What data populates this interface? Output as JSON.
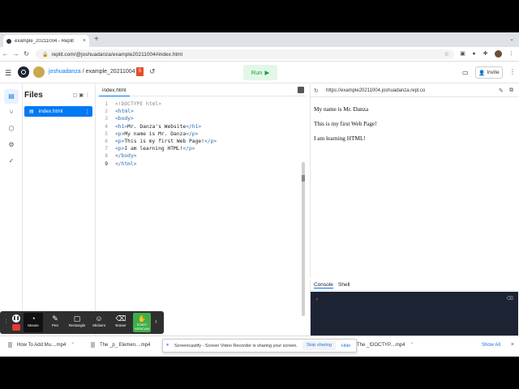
{
  "browser": {
    "tab_title": "example_20211004 - Replit",
    "tab_close": "×",
    "new_tab": "+",
    "url": "replit.com/@joshuadanza/example20211004#index.html"
  },
  "header": {
    "username": "joshuadanza",
    "separator": "/",
    "repl_name": "example_20211004",
    "html_badge": "5",
    "run_label": "Run",
    "invite_label": "Invite"
  },
  "files_panel": {
    "title": "Files",
    "items": [
      {
        "name": "index.html"
      }
    ]
  },
  "editor": {
    "tab_label": "index.html",
    "active_line": 9,
    "lines": [
      {
        "num": "1",
        "parts": [
          {
            "cls": "doctype",
            "text": "<!DOCTYPE html>"
          }
        ]
      },
      {
        "num": "2",
        "parts": [
          {
            "cls": "tag",
            "text": "<html>"
          }
        ]
      },
      {
        "num": "3",
        "parts": [
          {
            "cls": "tag",
            "text": "<body>"
          }
        ]
      },
      {
        "num": "4",
        "parts": [
          {
            "cls": "tag",
            "text": "<h1>"
          },
          {
            "cls": "txt",
            "text": "Mr. Danza's Website"
          },
          {
            "cls": "tag",
            "text": "</h1>"
          }
        ]
      },
      {
        "num": "5",
        "parts": [
          {
            "cls": "tag",
            "text": "<p>"
          },
          {
            "cls": "txt",
            "text": "My name is Mr. Danza"
          },
          {
            "cls": "tag",
            "text": "</p>"
          }
        ]
      },
      {
        "num": "6",
        "parts": [
          {
            "cls": "tag",
            "text": "<p>"
          },
          {
            "cls": "txt",
            "text": "This is my first Web Page!"
          },
          {
            "cls": "tag",
            "text": "</p>"
          }
        ]
      },
      {
        "num": "7",
        "parts": [
          {
            "cls": "tag",
            "text": "<p>"
          },
          {
            "cls": "txt",
            "text": "I am learning HTML!"
          },
          {
            "cls": "tag",
            "text": "</p>"
          }
        ]
      },
      {
        "num": "8",
        "parts": [
          {
            "cls": "tag",
            "text": "</body>"
          }
        ]
      },
      {
        "num": "9",
        "parts": [
          {
            "cls": "tag",
            "text": "</html>"
          }
        ]
      }
    ]
  },
  "webview": {
    "url": "https://example20211004.joshuadanza.repl.co",
    "paragraphs": [
      "My name is Mr. Danza",
      "This is my first Web Page!",
      "I am learning HTML!"
    ]
  },
  "console": {
    "tabs": [
      "Console",
      "Shell"
    ],
    "prompt": "›"
  },
  "screencastify": {
    "tools": [
      {
        "id": "mouse",
        "label": "Mouse",
        "icon": "◔"
      },
      {
        "id": "pen",
        "label": "Pen",
        "icon": "✎"
      },
      {
        "id": "rectangle",
        "label": "Rectangle",
        "icon": "▢"
      },
      {
        "id": "stickers",
        "label": "Stickers",
        "icon": "☺"
      },
      {
        "id": "eraser",
        "label": "Eraser",
        "icon": "⌫"
      }
    ],
    "start_label": "START WEBCAM",
    "share_message": "Screencastify - Screen Video Recorder is sharing your screen.",
    "stop_sharing": "Stop sharing",
    "hide": "Hide"
  },
  "downloads": {
    "items": [
      "How To Add Mu....mp4",
      "The _p_ Elemen....mp4",
      "The _!DOCTYP....mp4"
    ],
    "show_all": "Show All",
    "close": "×"
  },
  "colors": {
    "accent": "#0079f2",
    "run_green": "#11a33b",
    "console_bg": "#1c2333"
  }
}
